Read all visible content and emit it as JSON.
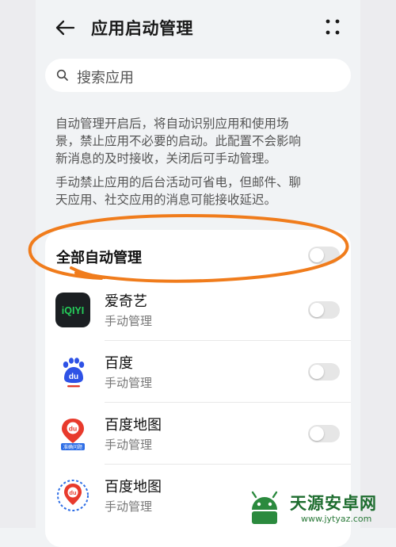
{
  "header": {
    "title": "应用启动管理",
    "back_icon": "arrow-left-icon",
    "more_icon": "more-dots-icon"
  },
  "search": {
    "placeholder": "搜索应用",
    "icon": "search-icon"
  },
  "description": {
    "paragraph1_line1": "自动管理开启后，将自动识别应用和使用场",
    "paragraph1_line2": "景，禁止应用不必要的启动。此配置不会影响",
    "paragraph1_line3": "新消息的及时接收，关闭后可手动管理。",
    "paragraph2_line1": "手动禁止应用的后台活动可省电，但邮件、聊",
    "paragraph2_line2": "天应用、社交应用的消息可能接收延迟。"
  },
  "all_auto": {
    "label": "全部自动管理",
    "enabled": false
  },
  "apps": [
    {
      "name": "爱奇艺",
      "status": "手动管理",
      "icon": "iqiyi-logo-icon",
      "icon_text": "iQIYI",
      "auto": false
    },
    {
      "name": "百度",
      "status": "手动管理",
      "icon": "baidu-paw-icon",
      "icon_text": "du",
      "auto": false
    },
    {
      "name": "百度地图",
      "status": "手动管理",
      "icon": "baidu-maps-icon",
      "icon_text": "du",
      "icon_caption": "准确问题",
      "auto": false
    },
    {
      "name": "百度地图",
      "status": "手动管理",
      "icon": "baidu-maps-icon",
      "icon_text": "du",
      "auto": false
    }
  ],
  "annotation": {
    "color": "#f07c1c",
    "shape": "hand-drawn-oval"
  },
  "watermark": {
    "title": "天源安卓网",
    "url": "www.jytyaz.com",
    "color": "#1e6d2f"
  },
  "colors": {
    "background": "#f1f3f5",
    "card": "#ffffff",
    "toggle_off": "#e6e6e6"
  }
}
